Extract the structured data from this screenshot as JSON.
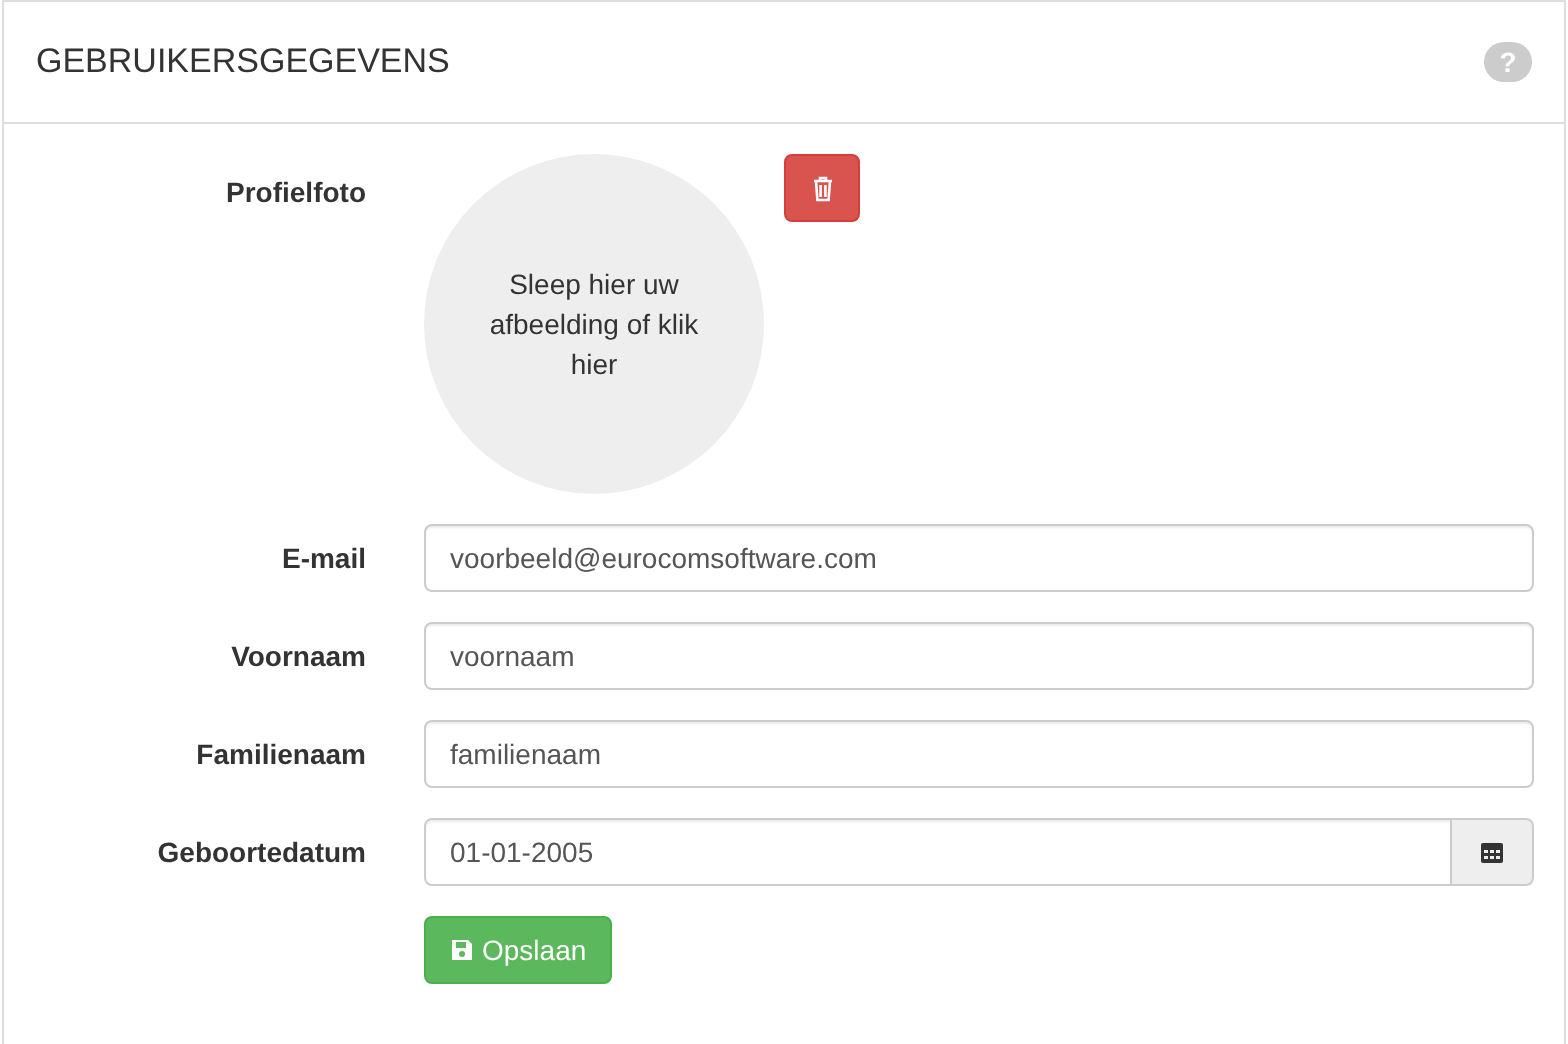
{
  "panel": {
    "title": "GEBRUIKERSGEGEVENS",
    "help": "?"
  },
  "photo": {
    "label": "Profielfoto",
    "dropzone_text": "Sleep hier uw afbeelding of klik hier"
  },
  "fields": [
    {
      "kind": "text",
      "label": "E-mail",
      "value": "voorbeeld@eurocomsoftware.com"
    },
    {
      "kind": "text",
      "label": "Voornaam",
      "value": "voornaam"
    },
    {
      "kind": "text",
      "label": "Familienaam",
      "value": "familienaam"
    },
    {
      "kind": "date",
      "label": "Geboortedatum",
      "value": "01-01-2005"
    }
  ],
  "save_button": "Opslaan"
}
